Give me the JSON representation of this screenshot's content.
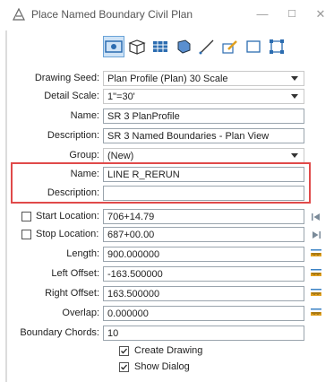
{
  "window": {
    "title": "Place Named Boundary Civil Plan",
    "minimize": "—",
    "maximize": "☐",
    "close": "✕"
  },
  "toolbar": {
    "tools": [
      {
        "name": "civil-plan-tool-icon",
        "active": true
      },
      {
        "name": "profile-tool-icon",
        "active": false
      },
      {
        "name": "grid-tool-icon",
        "active": false
      },
      {
        "name": "cross-section-tool-icon",
        "active": false
      },
      {
        "name": "line-tool-icon",
        "active": false
      },
      {
        "name": "edit-tool-icon",
        "active": false
      },
      {
        "name": "rectangle-tool-icon",
        "active": false
      },
      {
        "name": "shape-tool-icon",
        "active": false
      }
    ]
  },
  "form": {
    "drawing_seed_label": "Drawing Seed:",
    "drawing_seed_value": "Plan Profile (Plan) 30 Scale",
    "detail_scale_label": "Detail Scale:",
    "detail_scale_value": "1\"=30'",
    "name1_label": "Name:",
    "name1_value": "SR 3 PlanProfile",
    "description1_label": "Description:",
    "description1_value": "SR 3 Named Boundaries - Plan View",
    "group_label": "Group:",
    "group_value": "(New)",
    "name2_label": "Name:",
    "name2_value": "LINE R_RERUN",
    "description2_label": "Description:",
    "description2_value": "",
    "start_location_label": "Start Location:",
    "start_location_value": "706+14.79",
    "stop_location_label": "Stop Location:",
    "stop_location_value": "687+00.00",
    "length_label": "Length:",
    "length_value": "900.000000",
    "left_offset_label": "Left Offset:",
    "left_offset_value": "-163.500000",
    "right_offset_label": "Right Offset:",
    "right_offset_value": "163.500000",
    "overlap_label": "Overlap:",
    "overlap_value": "0.000000",
    "boundary_chords_label": "Boundary Chords:",
    "boundary_chords_value": "10",
    "create_drawing_label": "Create Drawing",
    "show_dialog_label": "Show Dialog"
  },
  "colors": {
    "highlight": "#e04a4a",
    "accent": "#3b82c4",
    "ruler": "#e0a020"
  }
}
